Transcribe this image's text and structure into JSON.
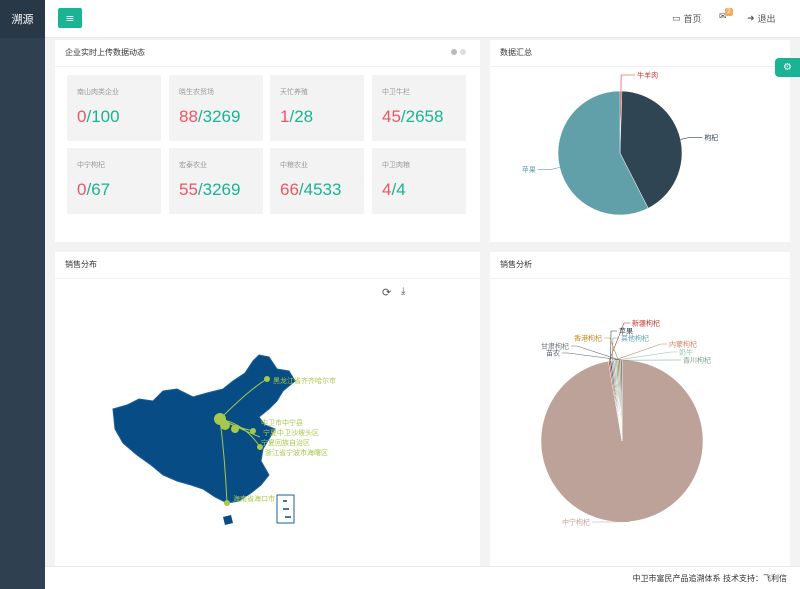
{
  "app": {
    "brand": "溯源"
  },
  "topbar": {
    "menu_icon": "hamburger-icon",
    "home_label": "首页",
    "mail_badge": "2",
    "logout_label": "退出"
  },
  "realtime": {
    "title": "企业实时上传数据动态",
    "stats": [
      {
        "label": "南山肉类企业",
        "done": "0",
        "total": "/100"
      },
      {
        "label": "晓生农贸场",
        "done": "88",
        "total": "/3269"
      },
      {
        "label": "天忙养殖",
        "done": "1",
        "total": "/28"
      },
      {
        "label": "中卫牛栏",
        "done": "45",
        "total": "/2658"
      },
      {
        "label": "中宁枸杞",
        "done": "0",
        "total": "/67"
      },
      {
        "label": "宏泰农业",
        "done": "55",
        "total": "/3269"
      },
      {
        "label": "中粮农业",
        "done": "66",
        "total": "/4533"
      },
      {
        "label": "中卫肉粮",
        "done": "4",
        "total": "/4"
      }
    ]
  },
  "summary": {
    "title": "数据汇总",
    "chart_data": {
      "type": "pie",
      "slices": [
        {
          "label": "牛羊肉",
          "value": 0.5,
          "color": "#c23531"
        },
        {
          "label": "枸杞",
          "value": 42,
          "color": "#2f4554"
        },
        {
          "label": "苹果",
          "value": 57.5,
          "color": "#61a0a8"
        }
      ]
    }
  },
  "distribution": {
    "title": "销售分布",
    "toolbar": {
      "refresh_icon": "refresh-icon",
      "download_icon": "download-icon"
    },
    "destinations": [
      "黑龙江省齐齐哈尔市",
      "中卫市中宁县",
      "宁夏中卫沙坡头区",
      "宁夏回族自治区",
      "浙江省宁波市海曙区",
      "海南省海口市"
    ]
  },
  "analysis": {
    "title": "销售分析",
    "chart_data": {
      "type": "pie",
      "slices": [
        {
          "label": "中宁枸杞",
          "value": 97.6,
          "color": "#bda29a"
        },
        {
          "label": "新疆枸杞",
          "value": 0.3,
          "color": "#c23531"
        },
        {
          "label": "苹果",
          "value": 0.3,
          "color": "#2f4554"
        },
        {
          "label": "其他枸杞",
          "value": 0.3,
          "color": "#61a0a8"
        },
        {
          "label": "内蒙枸杞",
          "value": 0.3,
          "color": "#d48265"
        },
        {
          "label": "奶牛",
          "value": 0.3,
          "color": "#91c7ae"
        },
        {
          "label": "青川枸杞",
          "value": 0.3,
          "color": "#749f83"
        },
        {
          "label": "香港枸杞",
          "value": 0.3,
          "color": "#ca8622"
        },
        {
          "label": "甘肃枸杞",
          "value": 0.3,
          "color": "#6e7074"
        },
        {
          "label": "苗农",
          "value": 0.3,
          "color": "#546570"
        }
      ]
    }
  },
  "footer": {
    "text": "中卫市富民产品追溯体系 技术支持：飞利信"
  }
}
